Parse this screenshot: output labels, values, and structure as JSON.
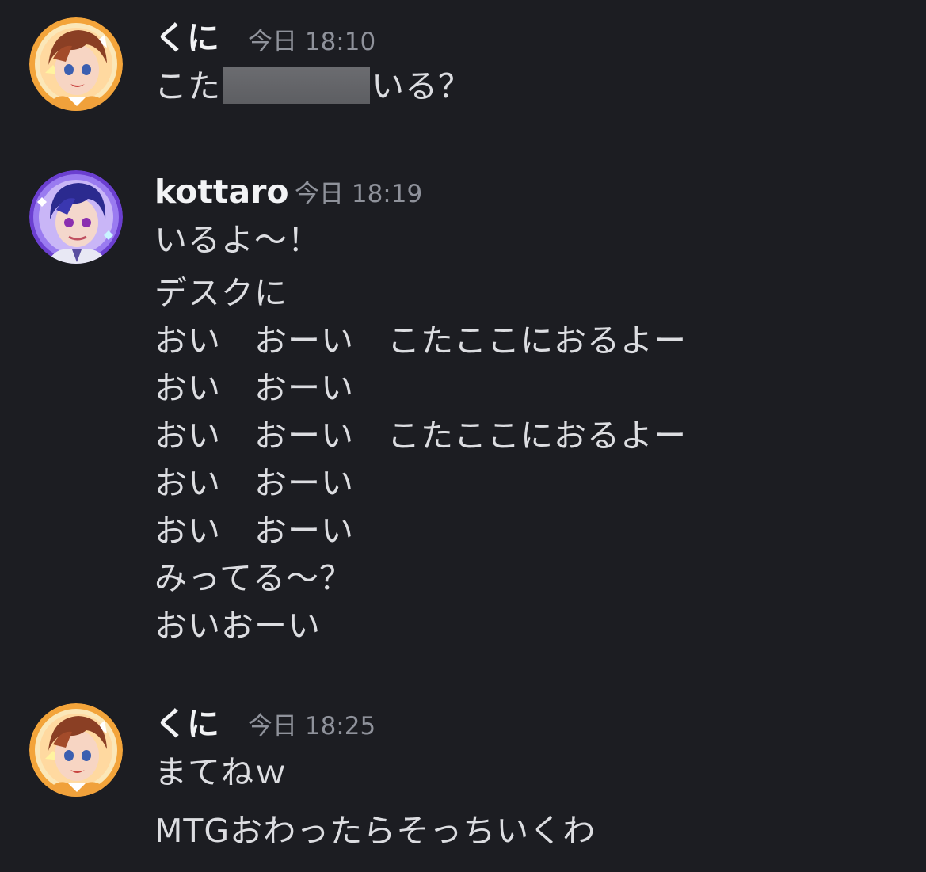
{
  "messages": [
    {
      "username": "くに",
      "timestamp": "今日 18:10",
      "lines": [
        {
          "before": "こた",
          "redacted": true,
          "after": "いる？"
        }
      ]
    },
    {
      "username": "kottaro",
      "timestamp": "今日 18:19",
      "lines": [
        "いるよ〜！",
        "デスクに",
        "おい　おーい　こたここにおるよー",
        "おい　おーい",
        "おい　おーい　こたここにおるよー",
        "おい　おーい",
        "おい　おーい",
        "みってる〜？",
        "おいおーい"
      ]
    },
    {
      "username": "くに",
      "timestamp": "今日 18:25",
      "lines": [
        "まてねｗ",
        "MTGおわったらそっちいくわ"
      ]
    }
  ],
  "colors": {
    "background": "#1c1d22",
    "username": "#f2f3f5",
    "timestamp": "#8f929b",
    "message_text": "#dcdde1",
    "redaction": "#646569"
  },
  "icons": {
    "kuni_avatar": "avatar-kuni-icon",
    "kottaro_avatar": "avatar-kottaro-icon"
  }
}
